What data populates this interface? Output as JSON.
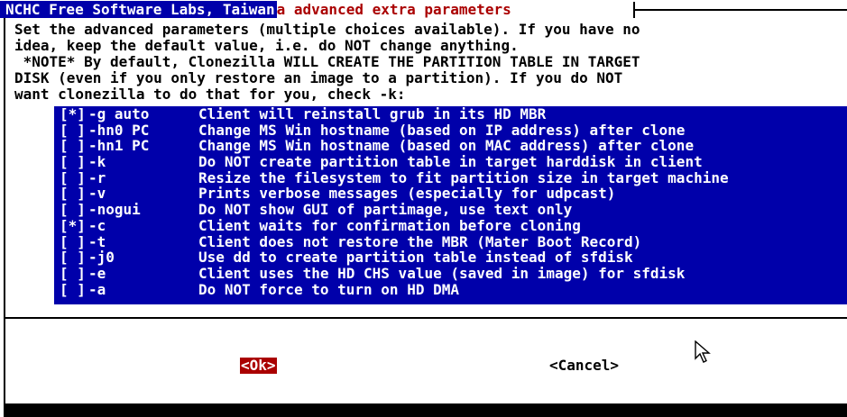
{
  "background_label": "NCHC Free Software Labs, Taiwan",
  "dialog": {
    "title": "a advanced extra parameters",
    "description": [
      "Set the advanced parameters (multiple choices available). If you have no",
      "idea, keep the default value, i.e. do NOT change anything.",
      " *NOTE* By default, Clonezilla WILL CREATE THE PARTITION TABLE IN TARGET",
      "DISK (even if you only restore an image to a partition). If you do NOT",
      "want clonezilla to do that for you, check -k:"
    ],
    "options": [
      {
        "check": "[*]",
        "option": "-g auto",
        "desc": "Client will reinstall grub in its HD MBR"
      },
      {
        "check": "[ ]",
        "option": "-hn0 PC",
        "desc": "Change MS Win hostname (based on IP address) after clone"
      },
      {
        "check": "[ ]",
        "option": "-hn1 PC",
        "desc": "Change MS Win hostname (based on MAC address) after clone"
      },
      {
        "check": "[ ]",
        "option": "-k",
        "desc": "Do NOT create partition table in target harddisk in client"
      },
      {
        "check": "[ ]",
        "option": "-r",
        "desc": "Resize the filesystem to fit partition size in target machine"
      },
      {
        "check": "[ ]",
        "option": "-v",
        "desc": "Prints verbose messages (especially for udpcast)"
      },
      {
        "check": "[ ]",
        "option": "-nogui",
        "desc": "Do NOT show GUI of partimage, use text only"
      },
      {
        "check": "[*]",
        "option": "-c",
        "desc": "Client waits for confirmation before cloning"
      },
      {
        "check": "[ ]",
        "option": "-t",
        "desc": "Client does not restore the MBR (Mater Boot Record)"
      },
      {
        "check": "[ ]",
        "option": "-j0",
        "desc": "Use dd to create partition table instead of sfdisk"
      },
      {
        "check": "[ ]",
        "option": "-e",
        "desc": "Client uses the HD CHS value (saved in image) for sfdisk"
      },
      {
        "check": "[ ]",
        "option": "-a",
        "desc": "Do NOT force to turn on HD DMA"
      }
    ],
    "ok_label": "<Ok>",
    "cancel_label": "<Cancel>"
  },
  "colors": {
    "list_background": "#0000aa",
    "title_text": "#aa0000",
    "ok_button_background": "#aa0000"
  }
}
